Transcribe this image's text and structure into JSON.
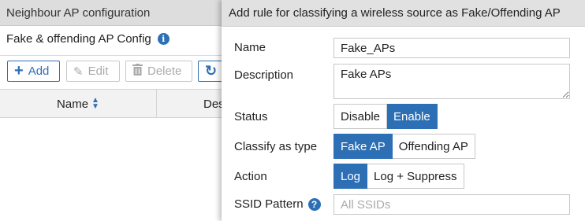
{
  "background": {
    "header_title": "Neighbour AP configuration",
    "config_title": "Fake & offending AP Config",
    "toolbar": {
      "add_label": "Add",
      "edit_label": "Edit",
      "delete_label": "Delete"
    },
    "table": {
      "columns": [
        "Name",
        "Des"
      ]
    }
  },
  "dialog": {
    "title": "Add rule for classifying a wireless source as Fake/Offending AP",
    "name": {
      "label": "Name",
      "value": "Fake_APs"
    },
    "description": {
      "label": "Description",
      "value": "Fake APs"
    },
    "status": {
      "label": "Status",
      "options": [
        "Disable",
        "Enable"
      ],
      "selected": "Enable"
    },
    "classify": {
      "label": "Classify as type",
      "options": [
        "Fake AP",
        "Offending AP"
      ],
      "selected": "Fake AP"
    },
    "action": {
      "label": "Action",
      "options": [
        "Log",
        "Log + Suppress"
      ],
      "selected": "Log"
    },
    "ssid": {
      "label": "SSID Pattern",
      "placeholder": "All SSIDs",
      "value": ""
    }
  },
  "colors": {
    "accent": "#2d6fb5",
    "header_bg": "#dddddd"
  }
}
